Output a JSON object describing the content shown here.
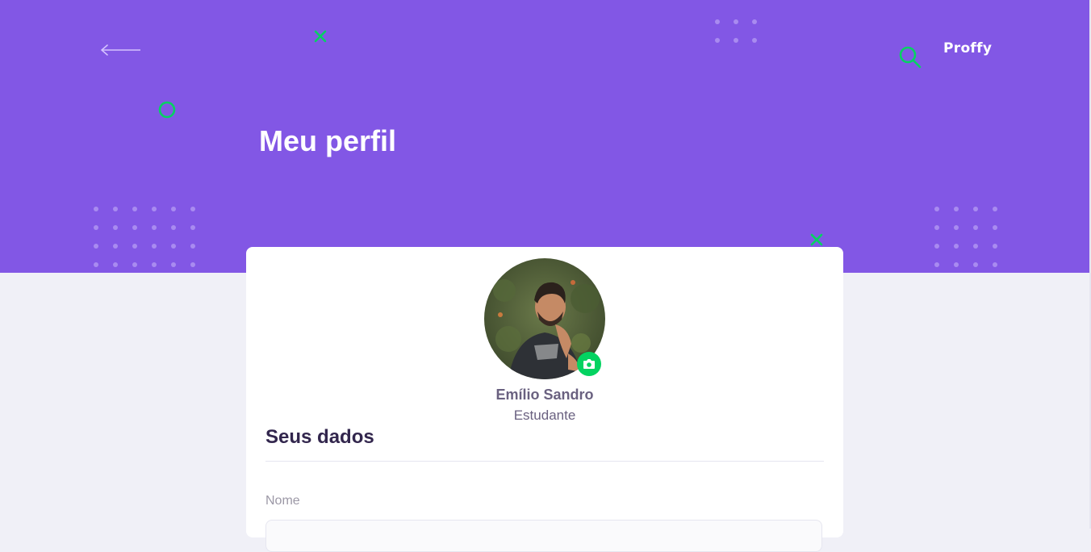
{
  "header": {
    "logo": "Proffy",
    "title": "Meu perfil"
  },
  "icons": {
    "back": "arrow-left-icon",
    "search": "search-icon",
    "camera": "camera-icon",
    "decor_x": "x-icon",
    "decor_circle": "circle-icon"
  },
  "colors": {
    "primary": "#8257E5",
    "accent_green": "#04D361",
    "background": "#F0F0F7",
    "title_dark": "#32264D",
    "text_base": "#6A6180",
    "text_muted": "#9C98A6"
  },
  "profile": {
    "name": "Emílio Sandro",
    "role": "Estudante"
  },
  "form": {
    "section_title": "Seus dados",
    "name_label": "Nome",
    "name_value": ""
  }
}
